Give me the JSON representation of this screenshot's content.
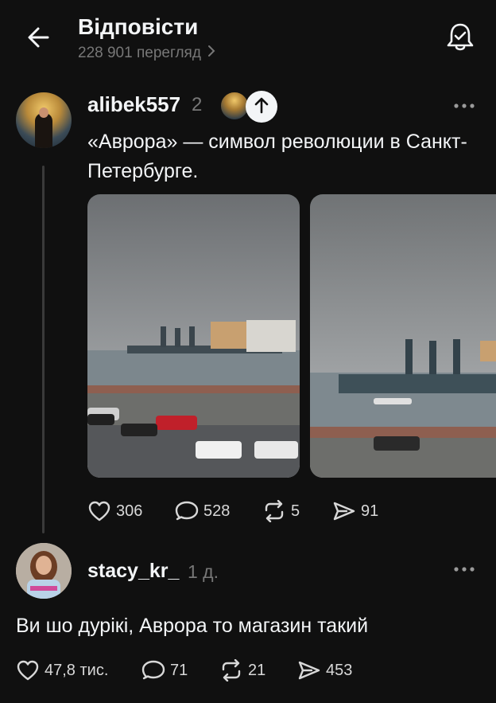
{
  "header": {
    "title": "Відповісти",
    "views": "228 901 перегляд",
    "back_icon": "arrow-left-icon",
    "notify_icon": "bell-check-icon"
  },
  "post": {
    "username": "alibek557",
    "time": "2",
    "text": "«Аврора» — символ революции в Санкт-Петербурге.",
    "likes": "306",
    "comments": "528",
    "reposts": "5",
    "shares": "91"
  },
  "reply": {
    "username": "stacy_kr_",
    "time": "1 д.",
    "text": "Ви шо дурікі, Аврора то магазин такий",
    "likes": "47,8 тис.",
    "comments": "71",
    "reposts": "21",
    "shares": "453"
  },
  "colors": {
    "background": "#101010",
    "text": "#f3f5f7",
    "muted": "#777777"
  }
}
